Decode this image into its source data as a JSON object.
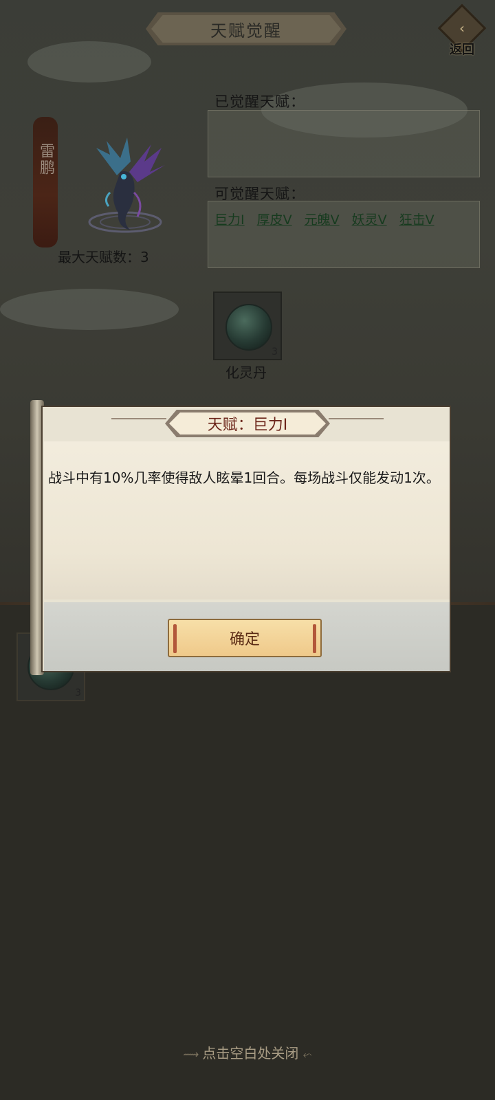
{
  "header": {
    "title": "天赋觉醒",
    "back_label": "返回"
  },
  "creature": {
    "name": "雷鹏",
    "max_talent_label": "最大天赋数：3"
  },
  "awakened": {
    "label": "已觉醒天赋："
  },
  "available": {
    "label": "可觉醒天赋：",
    "talents": [
      "巨力Ⅰ",
      "厚皮Ⅴ",
      "元魄Ⅴ",
      "妖灵Ⅴ",
      "狂击Ⅴ"
    ]
  },
  "item": {
    "name": "化灵丹",
    "count": "3"
  },
  "item2": {
    "count": "3"
  },
  "modal": {
    "title": "天赋：巨力Ⅰ",
    "description": "战斗中有10%几率使得敌人眩晕1回合。每场战斗仅能发动1次。",
    "confirm_label": "确定"
  },
  "close_hint": "点击空白处关闭"
}
